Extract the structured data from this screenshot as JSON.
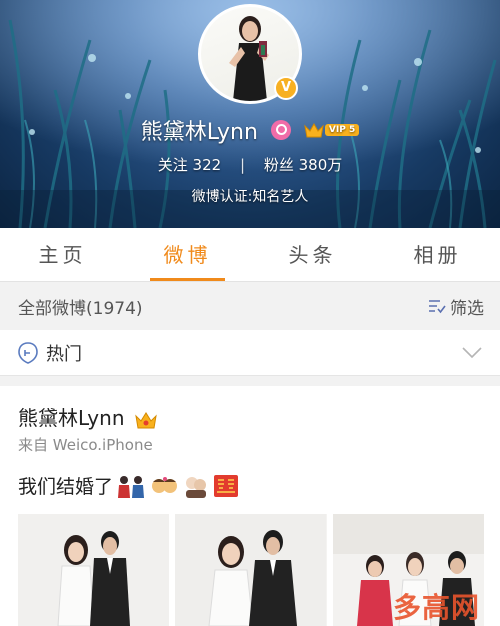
{
  "profile": {
    "name": "熊黛林Lynn",
    "vip_label": "VIP 5",
    "verify_badge": "V",
    "following_label": "关注",
    "following_count": "322",
    "followers_label": "粉丝",
    "followers_count": "380万",
    "separator": "|",
    "verification": "微博认证:知名艺人"
  },
  "tabs": [
    {
      "label": "主页",
      "active": false
    },
    {
      "label": "微博",
      "active": true
    },
    {
      "label": "头条",
      "active": false
    },
    {
      "label": "相册",
      "active": false
    }
  ],
  "filter": {
    "all_label": "全部微博(1974)",
    "filter_label": "筛选"
  },
  "hot": {
    "label": "热门"
  },
  "post": {
    "author": "熊黛林Lynn",
    "source": "来自 Weico.iPhone",
    "text": "我们结婚了"
  },
  "watermark": "多高网",
  "colors": {
    "accent": "#f08a1b",
    "vip": "#f9b11d",
    "watermark": "#e9542c",
    "gender": "#f06ca8"
  }
}
